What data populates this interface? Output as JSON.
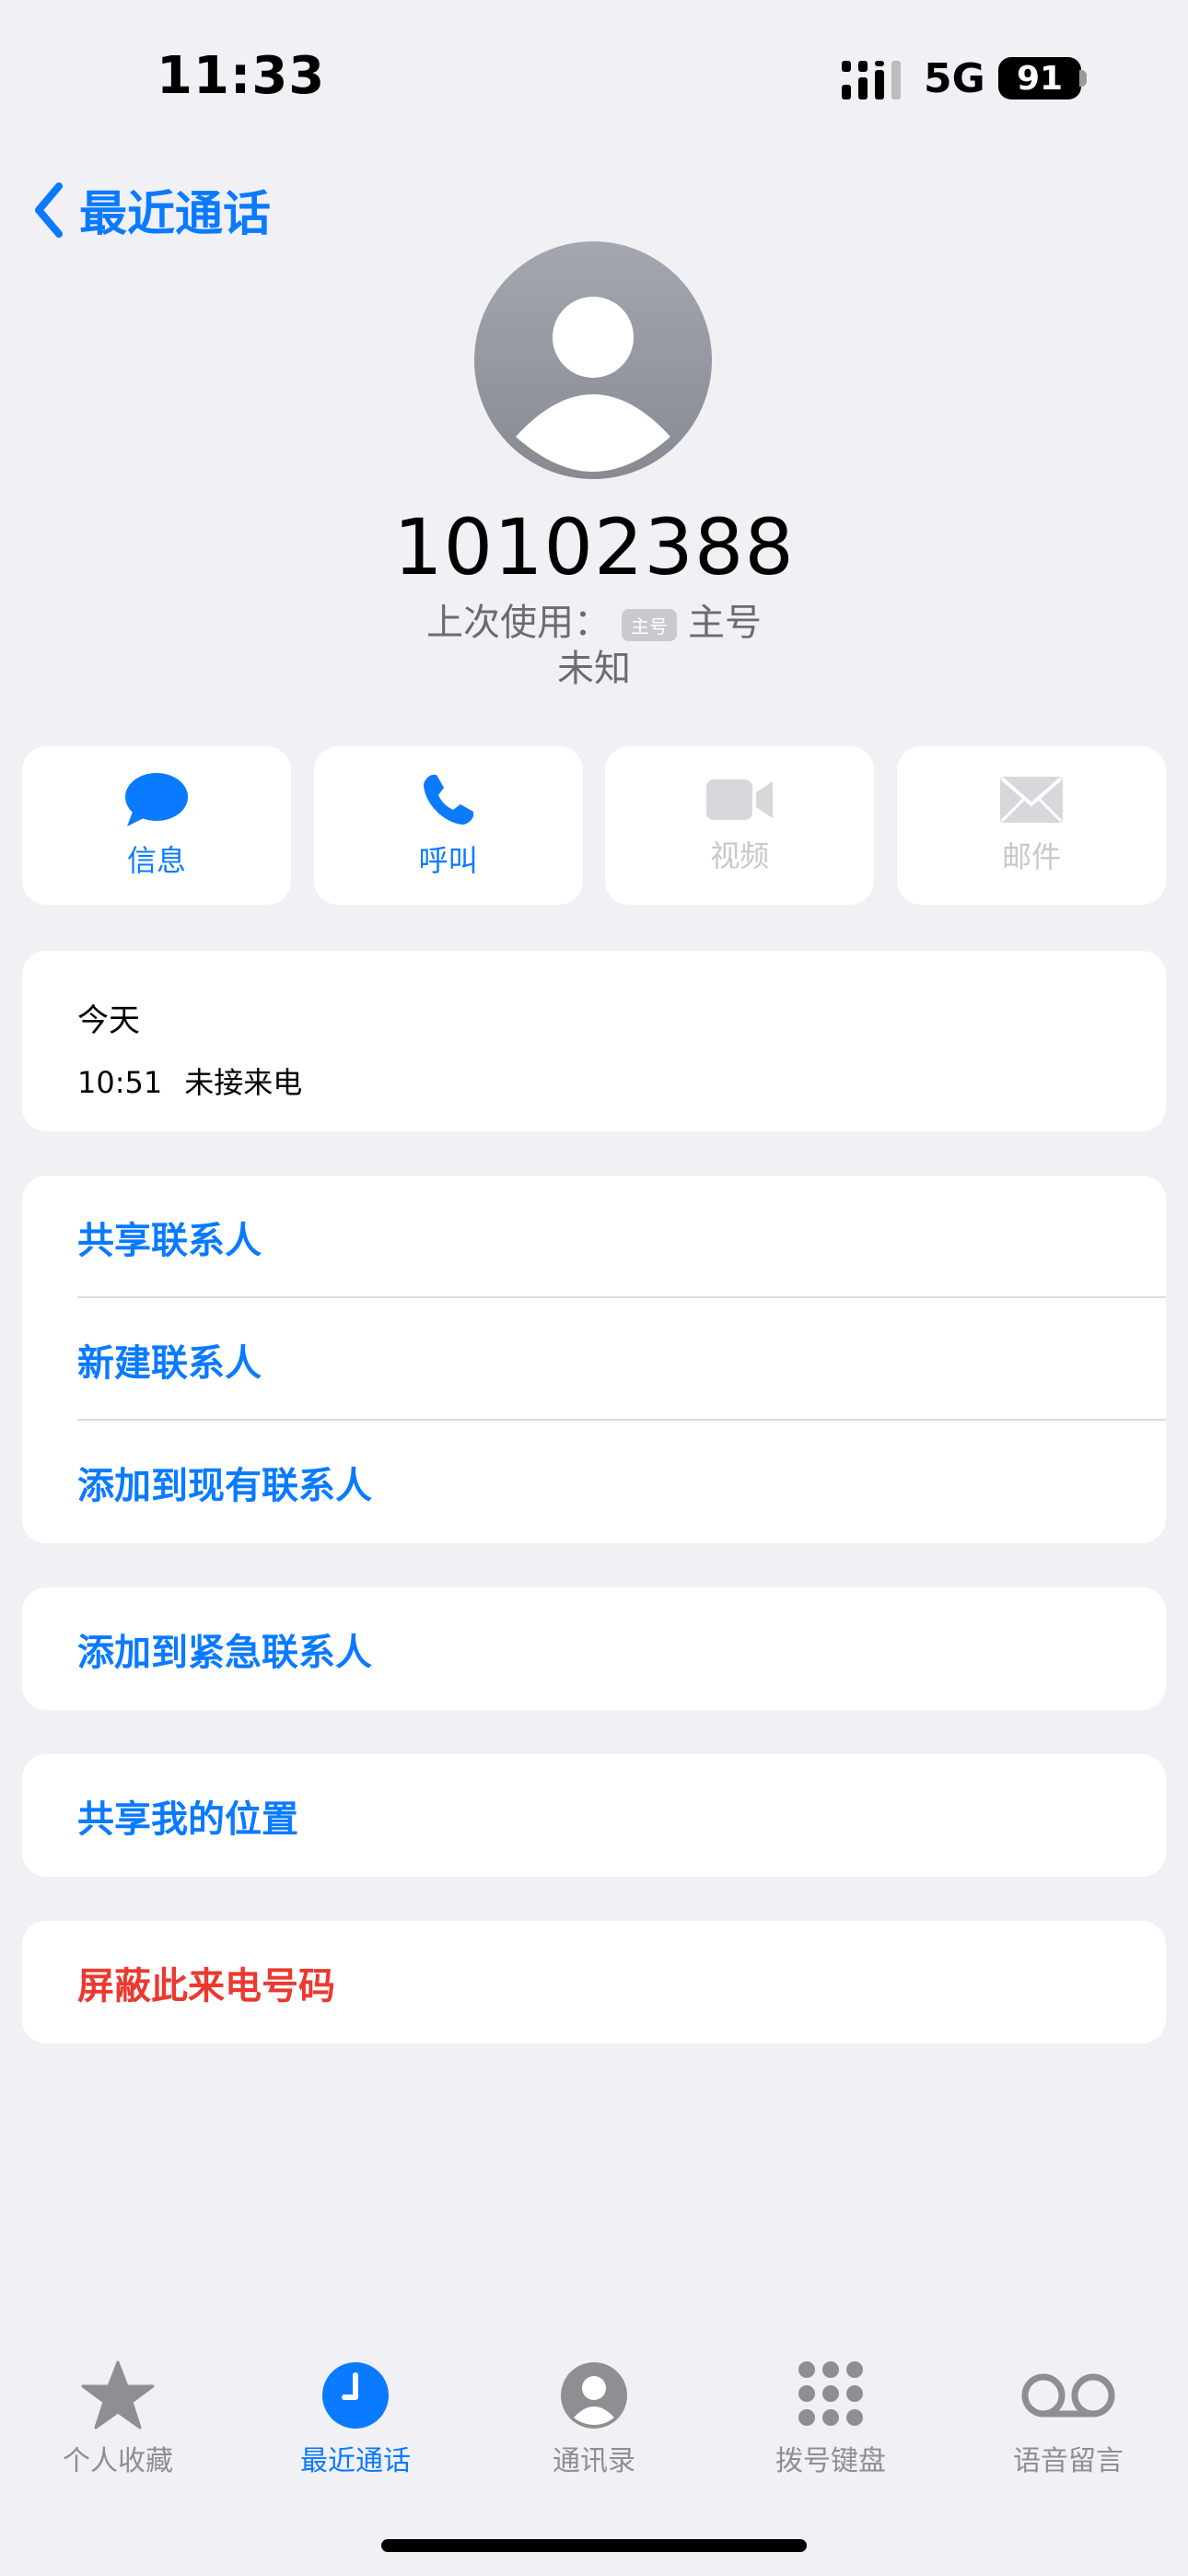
{
  "status_bar": {
    "time": "11:33",
    "network": "5G",
    "battery": "91"
  },
  "nav": {
    "back_label": "最近通话"
  },
  "contact": {
    "number": "10102388",
    "last_used_prefix": "上次使用：",
    "last_used_tag": "主号",
    "last_used_value": "主号",
    "location": "未知"
  },
  "actions": [
    {
      "label": "信息",
      "icon": "message-icon",
      "enabled": true
    },
    {
      "label": "呼叫",
      "icon": "phone-icon",
      "enabled": true
    },
    {
      "label": "视频",
      "icon": "video-icon",
      "enabled": false
    },
    {
      "label": "邮件",
      "icon": "mail-icon",
      "enabled": false
    }
  ],
  "history": {
    "day": "今天",
    "time": "10:51",
    "type": "未接来电"
  },
  "options_group1": [
    "共享联系人",
    "新建联系人",
    "添加到现有联系人"
  ],
  "emergency": "添加到紧急联系人",
  "share_location": "共享我的位置",
  "block": "屏蔽此来电号码",
  "tab_bar": [
    {
      "label": "个人收藏",
      "icon": "star-icon",
      "active": false
    },
    {
      "label": "最近通话",
      "icon": "clock-icon",
      "active": true
    },
    {
      "label": "通讯录",
      "icon": "contacts-icon",
      "active": false
    },
    {
      "label": "拨号键盘",
      "icon": "keypad-icon",
      "active": false
    },
    {
      "label": "语音留言",
      "icon": "voicemail-icon",
      "active": false
    }
  ],
  "colors": {
    "accent": "#0a7aff",
    "destructive": "#ea3a2f",
    "background": "#f0f0f5"
  }
}
